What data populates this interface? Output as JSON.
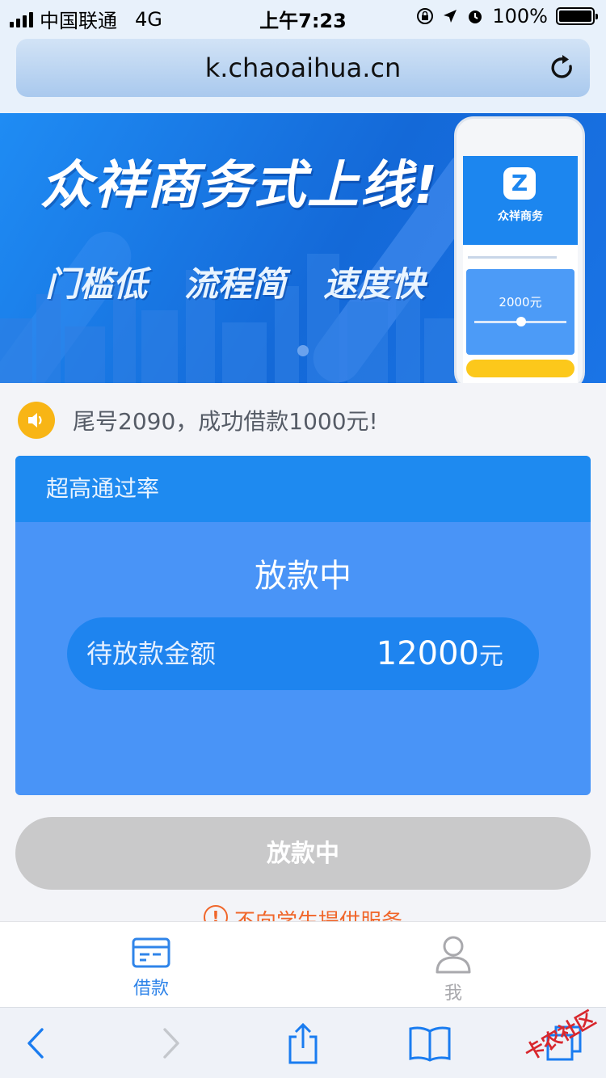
{
  "status_bar": {
    "carrier": "中国联通",
    "network": "4G",
    "time": "上午7:23",
    "battery": "100%"
  },
  "browser": {
    "url": "k.chaoaihua.cn"
  },
  "banner": {
    "title": "众祥商务式上线!",
    "features": [
      "门槛低",
      "流程简",
      "速度快"
    ],
    "phone_brand": "众祥商务",
    "phone_amount": "2000元"
  },
  "notice": {
    "text": "尾号2090，成功借款1000元!"
  },
  "card": {
    "header": "超高通过率",
    "status": "放款中",
    "amount_label": "待放款金额",
    "amount_value": "12000",
    "amount_unit": "元"
  },
  "main_button": {
    "label": "放款中"
  },
  "warning": {
    "text": "不向学生提供服务"
  },
  "tabbar": {
    "loan_label": "借款",
    "me_label": "我",
    "active_color": "#2f84e9",
    "inactive_color": "#a9a9ad"
  },
  "watermark": {
    "text": "卡农社区"
  },
  "colors": {
    "primary": "#1e8af0",
    "card": "#4994f7",
    "disabled": "#c9c9ca",
    "warning": "#f0662a",
    "notice_icon": "#f8b515"
  }
}
